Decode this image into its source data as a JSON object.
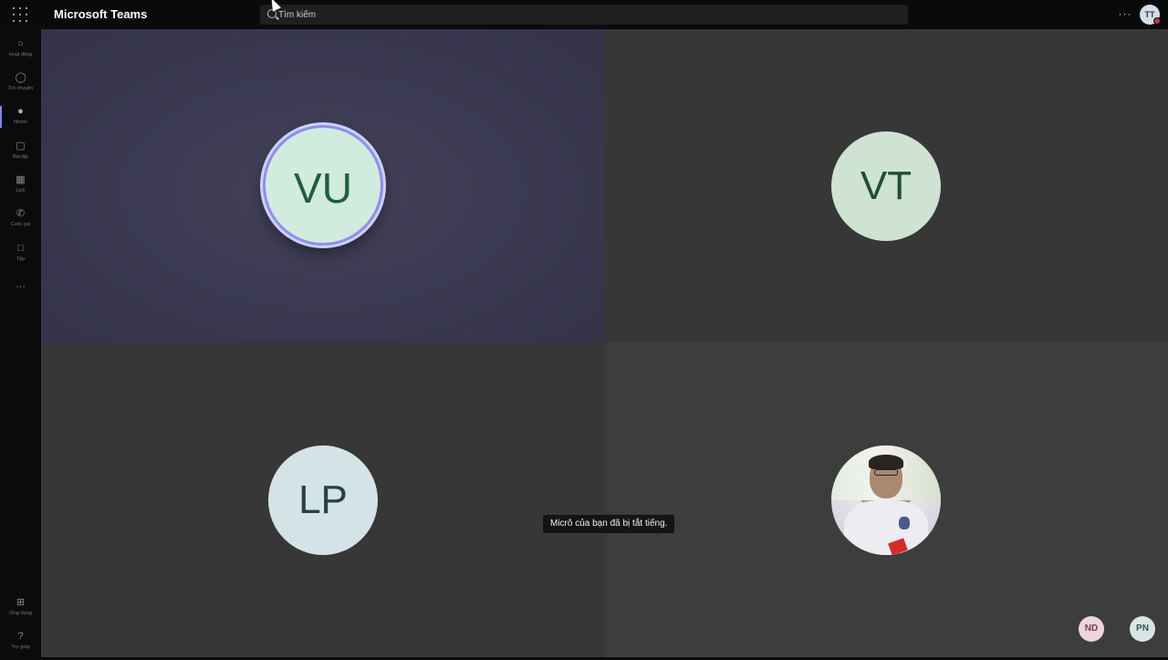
{
  "app": {
    "title": "Microsoft Teams"
  },
  "search": {
    "placeholder": "Tìm kiếm"
  },
  "header": {
    "more_label": "···",
    "user_initials": "TT"
  },
  "rail": {
    "items": [
      {
        "label": "Hoạt động",
        "icon": "bell-icon"
      },
      {
        "label": "Trò chuyện",
        "icon": "chat-icon"
      },
      {
        "label": "Nhóm",
        "icon": "teams-icon"
      },
      {
        "label": "Bài tập",
        "icon": "assignments-icon"
      },
      {
        "label": "Lịch",
        "icon": "calendar-icon"
      },
      {
        "label": "Cuộc gọi",
        "icon": "phone-icon"
      },
      {
        "label": "Tệp",
        "icon": "file-icon"
      },
      {
        "label": "Ứng dụng",
        "icon": "apps-icon"
      },
      {
        "label": "Trợ giúp",
        "icon": "help-icon"
      }
    ],
    "more_label": "···",
    "active_index": 2
  },
  "participants": {
    "tiles": [
      {
        "initials": "VU",
        "speaking": true
      },
      {
        "initials": "VT"
      },
      {
        "initials": "LP"
      },
      {
        "initials": "",
        "has_photo": true
      }
    ],
    "overflow": [
      {
        "initials": "ND"
      },
      {
        "initials": "PN"
      }
    ]
  },
  "toast": {
    "text": "Micrô của bạn đã bị tắt tiếng."
  },
  "colors": {
    "accent": "#7f85f5",
    "stage_bg": "#2b2b2b",
    "speaking_ring": "#8b8ff0"
  }
}
